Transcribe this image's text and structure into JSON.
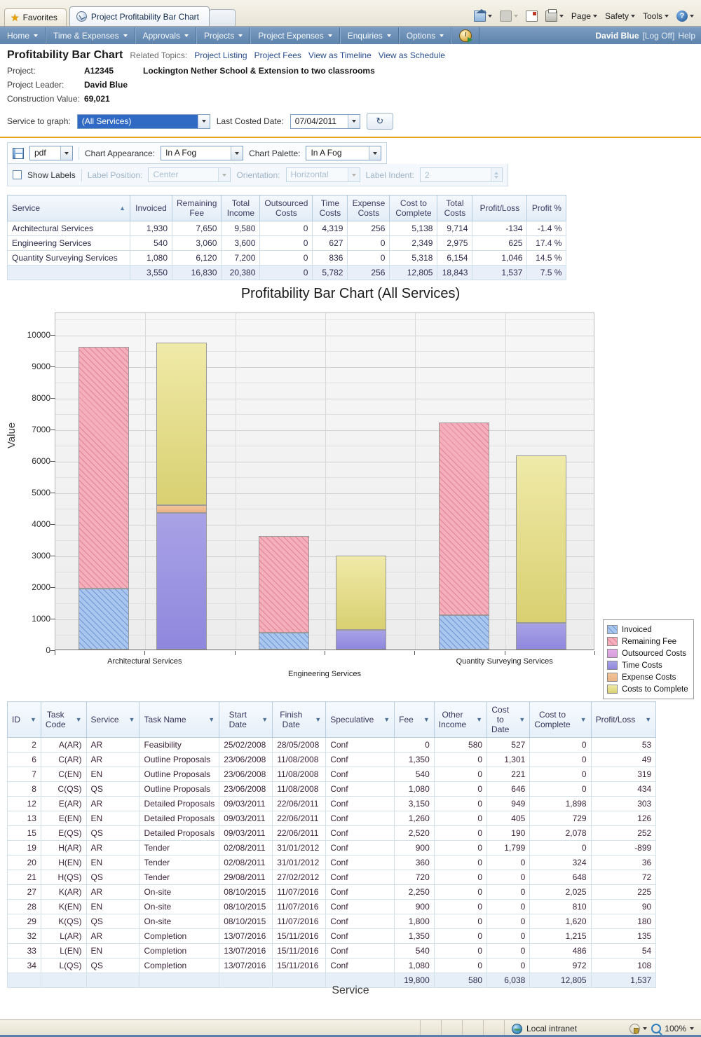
{
  "browser": {
    "favorites_label": "Favorites",
    "tab_title": "Project Profitability Bar Chart",
    "commands": [
      "Page",
      "Safety",
      "Tools"
    ],
    "icons": [
      "home-icon",
      "feed-icon",
      "mail-icon",
      "print-icon",
      "help-icon"
    ]
  },
  "appnav": {
    "items": [
      "Home",
      "Time & Expenses",
      "Approvals",
      "Projects",
      "Project Expenses",
      "Enquiries",
      "Options"
    ],
    "user": "David Blue",
    "logoff": "[Log Off]",
    "help": "Help"
  },
  "header": {
    "title": "Profitability Bar Chart",
    "related_label": "Related Topics:",
    "related_links": [
      "Project Listing",
      "Project Fees",
      "View as Timeline",
      "View as Schedule"
    ],
    "fields": [
      {
        "key": "Project:",
        "value": "A12345",
        "extra": "Lockington Nether School & Extension to two classrooms"
      },
      {
        "key": "Project Leader:",
        "value": "David Blue",
        "extra": ""
      },
      {
        "key": "Construction Value:",
        "value": "69,021",
        "extra": ""
      }
    ]
  },
  "filter": {
    "service_label": "Service to graph:",
    "service_value": "(All Services)",
    "date_label": "Last Costed Date:",
    "date_value": "07/04/2011",
    "refresh_glyph": "↻"
  },
  "toolbar": {
    "export_format": "pdf",
    "appearance_label": "Chart Appearance:",
    "appearance_value": "In A Fog",
    "palette_label": "Chart Palette:",
    "palette_value": "In A Fog",
    "show_labels": "Show Labels",
    "label_position_label": "Label Position:",
    "label_position_value": "Center",
    "orientation_label": "Orientation:",
    "orientation_value": "Horizontal",
    "label_indent_label": "Label Indent:",
    "label_indent_value": "2"
  },
  "summary_table": {
    "columns": [
      "Service",
      "Invoiced",
      "Remaining Fee",
      "Total Income",
      "Outsourced Costs",
      "Time Costs",
      "Expense Costs",
      "Cost to Complete",
      "Total Costs",
      "Profit/Loss",
      "Profit %"
    ],
    "rows": [
      [
        "Architectural Services",
        "1,930",
        "7,650",
        "9,580",
        "0",
        "4,319",
        "256",
        "5,138",
        "9,714",
        "-134",
        "-1.4 %"
      ],
      [
        "Engineering Services",
        "540",
        "3,060",
        "3,600",
        "0",
        "627",
        "0",
        "2,349",
        "2,975",
        "625",
        "17.4 %"
      ],
      [
        "Quantity Surveying Services",
        "1,080",
        "6,120",
        "7,200",
        "0",
        "836",
        "0",
        "5,318",
        "6,154",
        "1,046",
        "14.5 %"
      ]
    ],
    "total": [
      "",
      "3,550",
      "16,830",
      "20,380",
      "0",
      "5,782",
      "256",
      "12,805",
      "18,843",
      "1,537",
      "7.5 %"
    ]
  },
  "chart_data": {
    "type": "bar",
    "title": "Profitability Bar Chart (All Services)",
    "xlabel": "Service",
    "ylabel": "Value",
    "ylim": [
      0,
      10700
    ],
    "yticks": [
      0,
      1000,
      2000,
      3000,
      4000,
      5000,
      6000,
      7000,
      8000,
      9000,
      10000
    ],
    "grid": true,
    "legend_position": "right",
    "categories": [
      "Architectural Services",
      "Engineering Services",
      "Quantity Surveying Services"
    ],
    "series": [
      {
        "name": "Invoiced",
        "color": "#a9c6ef",
        "hatch": true,
        "stack": "income",
        "values": [
          1930,
          540,
          1080
        ]
      },
      {
        "name": "Remaining Fee",
        "color": "#f5aebb",
        "hatch": true,
        "stack": "income",
        "values": [
          7650,
          3060,
          6120
        ]
      },
      {
        "name": "Outsourced Costs",
        "color": "#e3aee8",
        "hatch": false,
        "stack": "costs",
        "values": [
          0,
          0,
          0
        ]
      },
      {
        "name": "Time Costs",
        "color": "#a9a2e6",
        "hatch": false,
        "stack": "costs",
        "values": [
          4319,
          627,
          836
        ]
      },
      {
        "name": "Expense Costs",
        "color": "#f2c49a",
        "hatch": false,
        "stack": "costs",
        "values": [
          256,
          0,
          0
        ]
      },
      {
        "name": "Costs to Complete",
        "color": "#efeaa8",
        "hatch": false,
        "stack": "costs",
        "values": [
          5138,
          2349,
          5318
        ]
      }
    ]
  },
  "task_table": {
    "columns": [
      "ID",
      "Task Code",
      "Service",
      "Task Name",
      "Start Date",
      "Finish Date",
      "Speculative",
      "Fee",
      "Other Income",
      "Cost to Date",
      "Cost to Complete",
      "Profit/Loss"
    ],
    "rows": [
      [
        "2",
        "A(AR)",
        "AR",
        "Feasibility",
        "25/02/2008",
        "28/05/2008",
        "Conf",
        "0",
        "580",
        "527",
        "0",
        "53"
      ],
      [
        "6",
        "C(AR)",
        "AR",
        "Outline Proposals",
        "23/06/2008",
        "11/08/2008",
        "Conf",
        "1,350",
        "0",
        "1,301",
        "0",
        "49"
      ],
      [
        "7",
        "C(EN)",
        "EN",
        "Outline Proposals",
        "23/06/2008",
        "11/08/2008",
        "Conf",
        "540",
        "0",
        "221",
        "0",
        "319"
      ],
      [
        "8",
        "C(QS)",
        "QS",
        "Outline Proposals",
        "23/06/2008",
        "11/08/2008",
        "Conf",
        "1,080",
        "0",
        "646",
        "0",
        "434"
      ],
      [
        "12",
        "E(AR)",
        "AR",
        "Detailed Proposals",
        "09/03/2011",
        "22/06/2011",
        "Conf",
        "3,150",
        "0",
        "949",
        "1,898",
        "303"
      ],
      [
        "13",
        "E(EN)",
        "EN",
        "Detailed Proposals",
        "09/03/2011",
        "22/06/2011",
        "Conf",
        "1,260",
        "0",
        "405",
        "729",
        "126"
      ],
      [
        "15",
        "E(QS)",
        "QS",
        "Detailed Proposals",
        "09/03/2011",
        "22/06/2011",
        "Conf",
        "2,520",
        "0",
        "190",
        "2,078",
        "252"
      ],
      [
        "19",
        "H(AR)",
        "AR",
        "Tender",
        "02/08/2011",
        "31/01/2012",
        "Conf",
        "900",
        "0",
        "1,799",
        "0",
        "-899"
      ],
      [
        "20",
        "H(EN)",
        "EN",
        "Tender",
        "02/08/2011",
        "31/01/2012",
        "Conf",
        "360",
        "0",
        "0",
        "324",
        "36"
      ],
      [
        "21",
        "H(QS)",
        "QS",
        "Tender",
        "29/08/2011",
        "27/02/2012",
        "Conf",
        "720",
        "0",
        "0",
        "648",
        "72"
      ],
      [
        "27",
        "K(AR)",
        "AR",
        "On-site",
        "08/10/2015",
        "11/07/2016",
        "Conf",
        "2,250",
        "0",
        "0",
        "2,025",
        "225"
      ],
      [
        "28",
        "K(EN)",
        "EN",
        "On-site",
        "08/10/2015",
        "11/07/2016",
        "Conf",
        "900",
        "0",
        "0",
        "810",
        "90"
      ],
      [
        "29",
        "K(QS)",
        "QS",
        "On-site",
        "08/10/2015",
        "11/07/2016",
        "Conf",
        "1,800",
        "0",
        "0",
        "1,620",
        "180"
      ],
      [
        "32",
        "L(AR)",
        "AR",
        "Completion",
        "13/07/2016",
        "15/11/2016",
        "Conf",
        "1,350",
        "0",
        "0",
        "1,215",
        "135"
      ],
      [
        "33",
        "L(EN)",
        "EN",
        "Completion",
        "13/07/2016",
        "15/11/2016",
        "Conf",
        "540",
        "0",
        "0",
        "486",
        "54"
      ],
      [
        "34",
        "L(QS)",
        "QS",
        "Completion",
        "13/07/2016",
        "15/11/2016",
        "Conf",
        "1,080",
        "0",
        "0",
        "972",
        "108"
      ]
    ],
    "total": [
      "",
      "",
      "",
      "",
      "",
      "",
      "",
      "19,800",
      "580",
      "6,038",
      "12,805",
      "1,537"
    ]
  },
  "statusbar": {
    "zone": "Local intranet",
    "zoom": "100%"
  }
}
